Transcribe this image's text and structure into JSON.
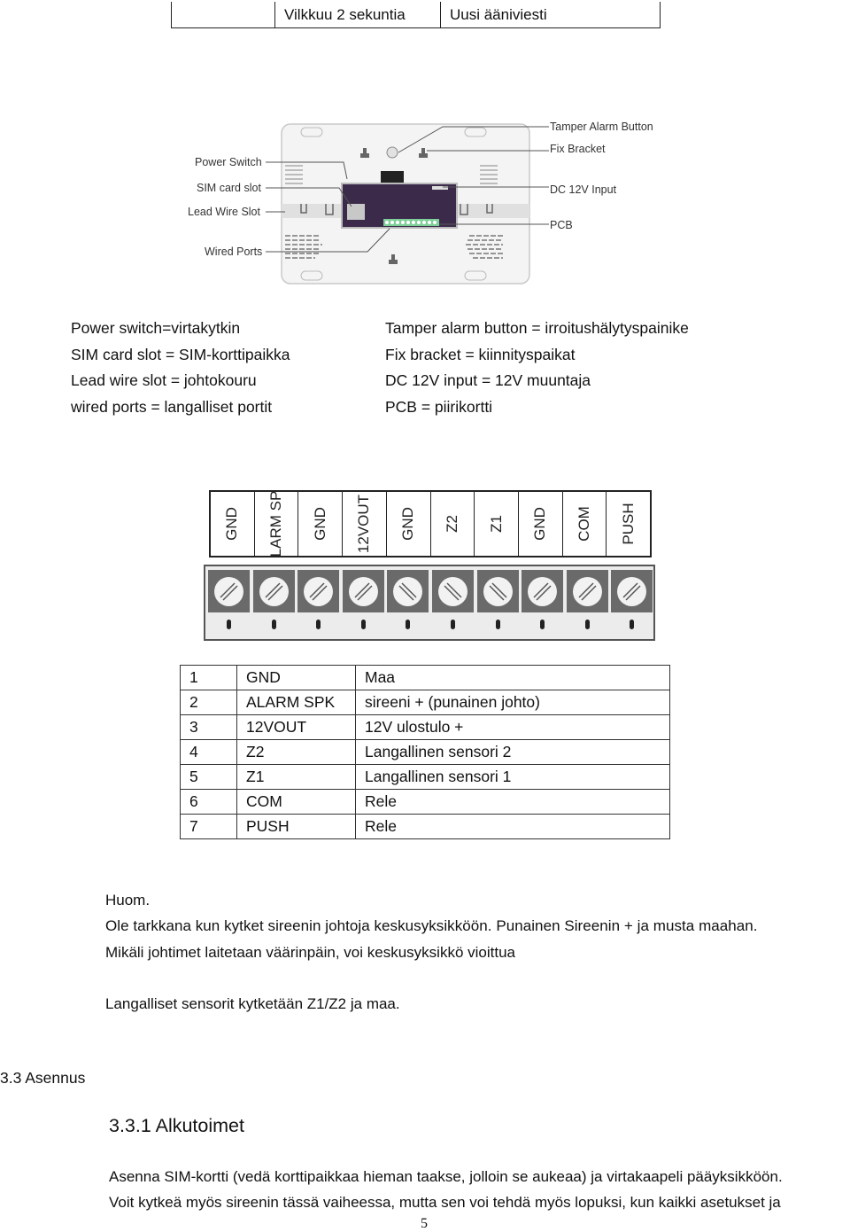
{
  "top_table": {
    "cells": [
      "",
      "Vilkkuu 2 sekuntia",
      "Uusi ääniviesti"
    ]
  },
  "device_diagram": {
    "callouts_left": [
      "Power Switch",
      "SIM card slot",
      "Lead Wire Slot",
      "Wired Ports"
    ],
    "callouts_right": [
      "Tamper Alarm Button",
      "Fix Bracket",
      "DC 12V Input",
      "PCB"
    ],
    "colors": {
      "pcb": "#3b2a4a",
      "terminal": "#7fcf9a",
      "housing": "#f3f3f3"
    }
  },
  "legend": {
    "left": [
      "Power switch=virtakytkin",
      "SIM card slot = SIM-korttipaikka",
      "Lead wire slot = johtokouru",
      "wired ports = langalliset portit"
    ],
    "right": [
      "Tamper alarm button = irroitushälytyspainike",
      "Fix bracket = kiinnityspaikat",
      "DC 12V input = 12V muuntaja",
      "PCB = piirikortti"
    ]
  },
  "terminal_block": {
    "labels": [
      "GND",
      "ALARM SPK",
      "GND",
      "12VOUT",
      "GND",
      "Z2",
      "Z1",
      "GND",
      "COM",
      "PUSH"
    ],
    "screw_slot_directions": [
      "/",
      "/",
      "/",
      "/",
      "\\",
      "\\",
      "\\",
      "/",
      "/",
      "/"
    ]
  },
  "pin_table": {
    "rows": [
      {
        "num": "1",
        "pin": "GND",
        "desc": "Maa"
      },
      {
        "num": "2",
        "pin": "ALARM SPK",
        "desc": "sireeni + (punainen johto)"
      },
      {
        "num": "3",
        "pin": "12VOUT",
        "desc": "12V ulostulo +"
      },
      {
        "num": "4",
        "pin": "Z2",
        "desc": "Langallinen sensori 2"
      },
      {
        "num": "5",
        "pin": "Z1",
        "desc": "Langallinen sensori 1"
      },
      {
        "num": "6",
        "pin": "COM",
        "desc": "Rele"
      },
      {
        "num": "7",
        "pin": "PUSH",
        "desc": "Rele"
      }
    ]
  },
  "note": {
    "title": "Huom.",
    "line1": "Ole tarkkana kun kytket sireenin johtoja keskusyksikköön. Punainen Sireenin + ja musta maahan.",
    "line2": "Mikäli johtimet laitetaan väärinpäin, voi keskusyksikkö vioittua",
    "line3": "Langalliset sensorit kytketään Z1/Z2 ja maa."
  },
  "section": {
    "heading": "3.3 Asennus",
    "subheading": "3.3.1 Alkutoimet",
    "para1": "Asenna SIM-kortti (vedä korttipaikkaa hieman taakse, jolloin se aukeaa) ja virtakaapeli pääyksikköön.",
    "para2": "Voit kytkeä myös sireenin tässä vaiheessa, mutta sen voi tehdä myös lopuksi, kun kaikki asetukset ja"
  },
  "page_number": "5"
}
